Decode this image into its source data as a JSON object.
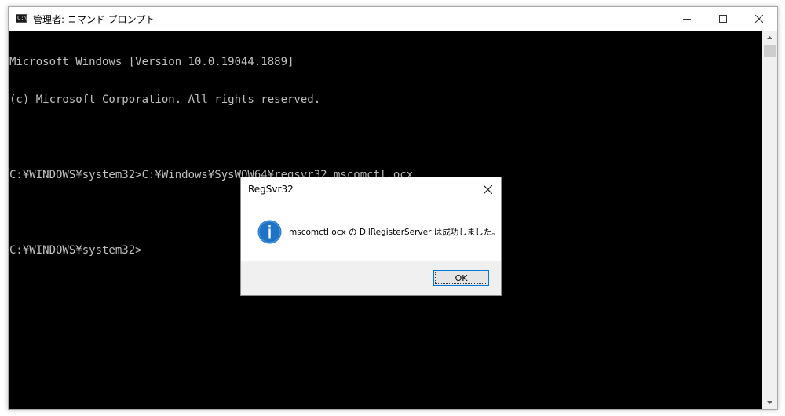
{
  "window": {
    "title": "管理者: コマンド プロンプト",
    "icon": "cmd-icon",
    "icon_text": "C:\\",
    "buttons": {
      "minimize": "minimize-icon",
      "maximize": "maximize-icon",
      "close": "close-icon"
    }
  },
  "console": {
    "lines": [
      "Microsoft Windows [Version 10.0.19044.1889]",
      "(c) Microsoft Corporation. All rights reserved.",
      "",
      "C:¥WINDOWS¥system32>C:¥Windows¥SysWOW64¥regsvr32 mscomctl.ocx",
      "",
      "C:¥WINDOWS¥system32>"
    ],
    "text_color": "#c0c0c0",
    "background": "#000000"
  },
  "dialog": {
    "title": "RegSvr32",
    "message": "mscomctl.ocx の DllRegisterServer は成功しました。",
    "icon": "info-icon",
    "ok_label": "OK",
    "accent": "#0078d7",
    "icon_color": "#1e73c7"
  }
}
